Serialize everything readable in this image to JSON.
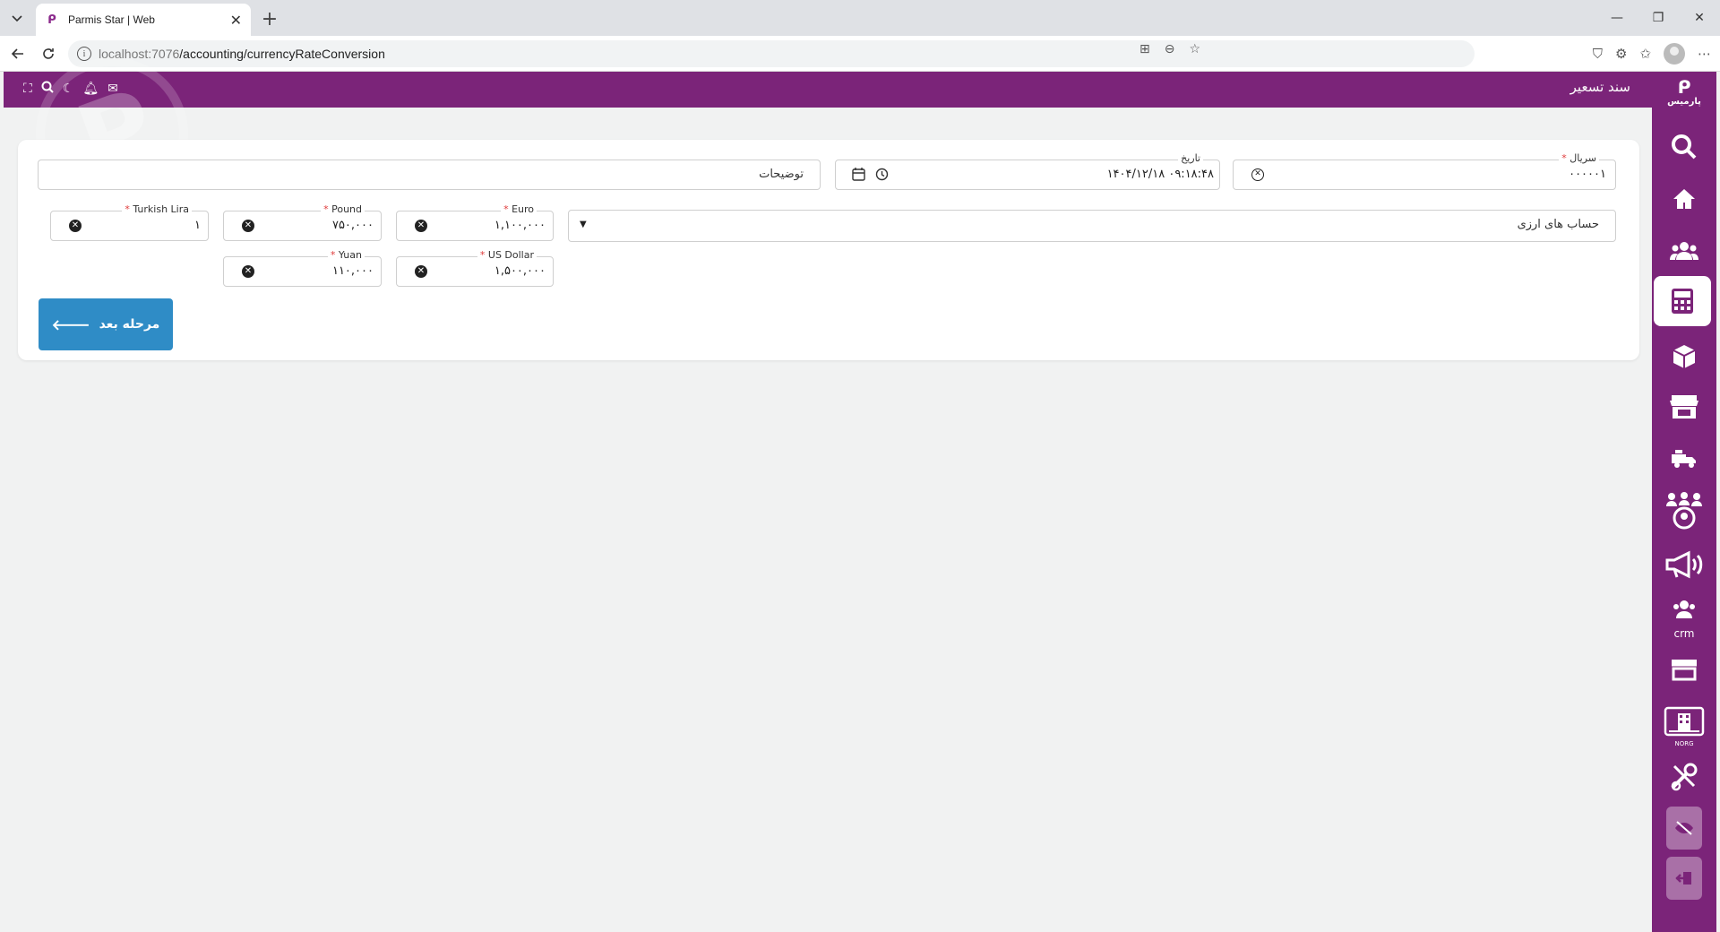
{
  "browser": {
    "tab_title": "Parmis Star | Web",
    "url_host": "localhost:7076",
    "url_path": "/accounting/currencyRateConversion"
  },
  "header": {
    "title": "سند تسعیر"
  },
  "sidebar": {
    "logo_text": "پارمیس",
    "crm_label": "crm",
    "norg_label": "NORG"
  },
  "form": {
    "serial": {
      "label": "سریال",
      "value": "۰۰۰۰۰۱"
    },
    "date": {
      "label": "تاریخ",
      "value": "۰۹:۱۸:۴۸ ۱۴۰۴/۱۲/۱۸"
    },
    "description": {
      "placeholder": "توضیحات"
    },
    "accounts": {
      "placeholder": "حساب های ارزی"
    },
    "currencies": {
      "euro": {
        "label": "Euro",
        "value": "۱,۱۰۰,۰۰۰"
      },
      "pound": {
        "label": "Pound",
        "value": "۷۵۰,۰۰۰"
      },
      "turkish_lira": {
        "label": "Turkish Lira",
        "value": "۱"
      },
      "us_dollar": {
        "label": "US Dollar",
        "value": "۱,۵۰۰,۰۰۰"
      },
      "yuan": {
        "label": "Yuan",
        "value": "۱۱۰,۰۰۰"
      }
    },
    "next_button": "مرحله بعد"
  },
  "colors": {
    "brand": "#7b2479",
    "primary_button": "#2f8cc6",
    "required": "#e03b3b"
  }
}
